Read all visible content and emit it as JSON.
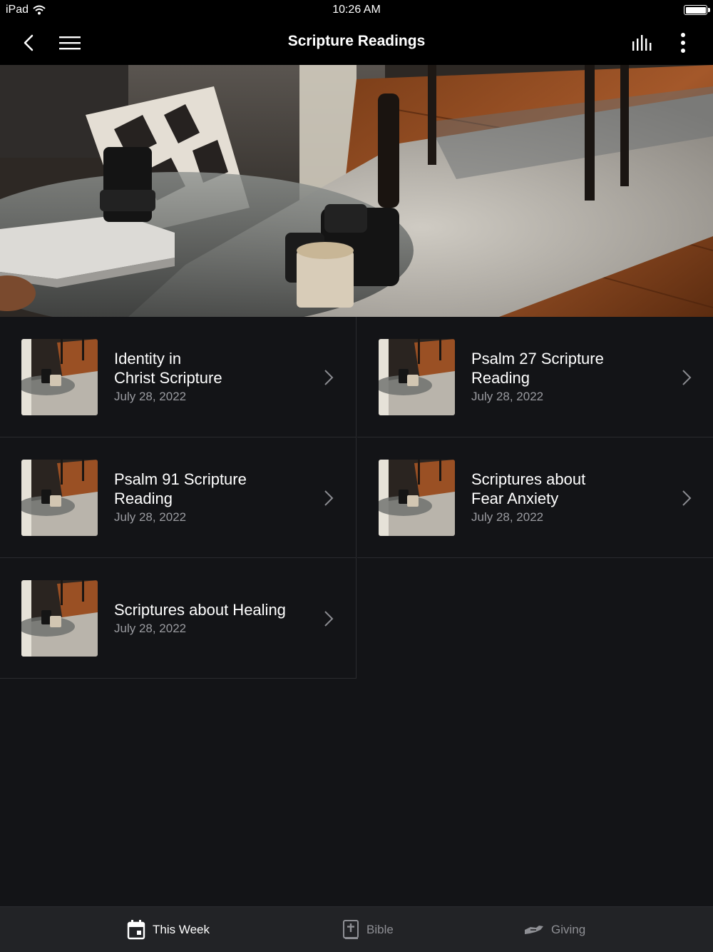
{
  "status_bar": {
    "device": "iPad",
    "time": "10:26 AM"
  },
  "nav": {
    "title": "Scripture Readings",
    "back_icon": "chevron-left-icon",
    "menu_icon": "hamburger-menu-icon",
    "audio_icon": "audio-bars-icon",
    "more_icon": "vertical-ellipsis-icon"
  },
  "items": [
    {
      "title": "Identity in\nChrist Scripture",
      "date": "July 28, 2022"
    },
    {
      "title": "Psalm 27 Scripture\nReading",
      "date": "July 28, 2022"
    },
    {
      "title": "Psalm 91 Scripture\nReading",
      "date": "July 28, 2022"
    },
    {
      "title": "Scriptures about\nFear Anxiety",
      "date": "July 28, 2022"
    },
    {
      "title": "Scriptures about Healing",
      "date": "July 28, 2022"
    }
  ],
  "tabs": [
    {
      "label": "This Week",
      "icon": "calendar-icon",
      "active": true
    },
    {
      "label": "Bible",
      "icon": "bible-icon",
      "active": false
    },
    {
      "label": "Giving",
      "icon": "giving-hand-icon",
      "active": false
    }
  ],
  "colors": {
    "background": "#131417",
    "nav": "#000000",
    "tab_bar": "#222326",
    "muted": "#9a9ba0"
  }
}
